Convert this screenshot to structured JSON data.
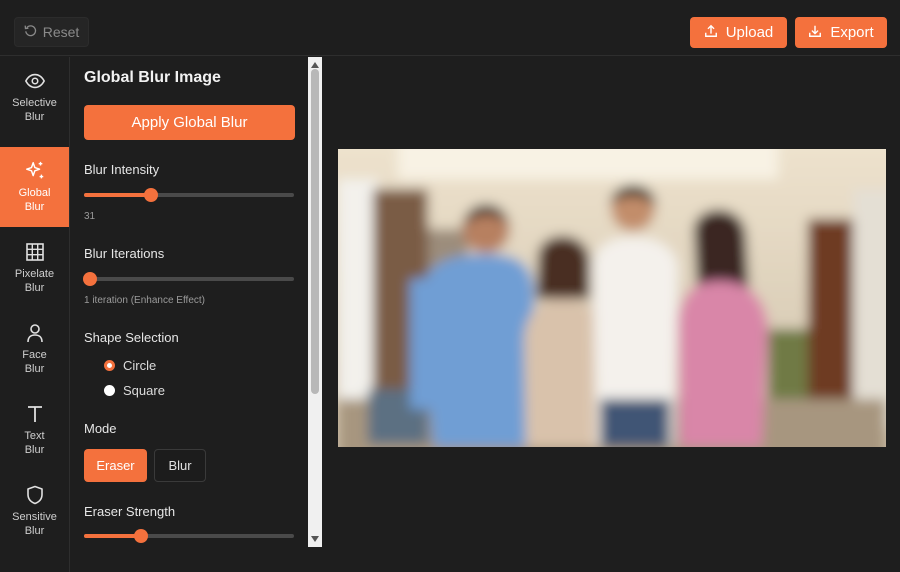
{
  "topbar": {
    "reset_label": "Reset",
    "upload_label": "Upload",
    "export_label": "Export"
  },
  "rail": {
    "items": [
      {
        "label": "Selective\nBlur",
        "icon": "eye-icon",
        "active": false
      },
      {
        "label": "Global\nBlur",
        "icon": "sparkles-icon",
        "active": true
      },
      {
        "label": "Pixelate\nBlur",
        "icon": "grid-icon",
        "active": false
      },
      {
        "label": "Face\nBlur",
        "icon": "person-icon",
        "active": false
      },
      {
        "label": "Text\nBlur",
        "icon": "text-icon",
        "active": false
      },
      {
        "label": "Sensitive\nBlur",
        "icon": "shield-icon",
        "active": false
      }
    ]
  },
  "panel": {
    "title": "Global Blur Image",
    "apply_label": "Apply Global Blur",
    "blur_intensity": {
      "label": "Blur Intensity",
      "value": "31",
      "fraction": 0.32
    },
    "blur_iterations": {
      "label": "Blur Iterations",
      "value_text": "1 iteration (Enhance Effect)",
      "fraction": 0.03
    },
    "shape": {
      "label": "Shape Selection",
      "options": [
        "Circle",
        "Square"
      ],
      "selected": "Circle"
    },
    "mode": {
      "label": "Mode",
      "options": [
        "Eraser",
        "Blur"
      ],
      "selected": "Eraser"
    },
    "eraser_strength": {
      "label": "Eraser Strength",
      "fraction": 0.27
    }
  },
  "colors": {
    "accent": "#f4713d",
    "background": "#1e1e1e"
  }
}
